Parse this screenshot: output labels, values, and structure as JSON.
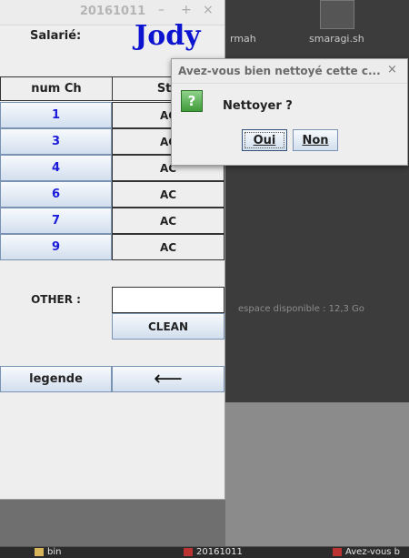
{
  "main_window": {
    "title": "20161011",
    "minimize": "–",
    "maximize": "+",
    "close": "×",
    "salarie_label": "Salarié:",
    "salarie_name": "Jody",
    "columns": [
      "num Ch",
      "Sta"
    ],
    "rows": [
      {
        "num": "1",
        "status": "AC"
      },
      {
        "num": "3",
        "status": "AC"
      },
      {
        "num": "4",
        "status": "AC"
      },
      {
        "num": "6",
        "status": "AC"
      },
      {
        "num": "7",
        "status": "AC"
      },
      {
        "num": "9",
        "status": "AC"
      }
    ],
    "other_label": "OTHER :",
    "other_value": "",
    "clean_label": "CLEAN",
    "legende_label": "legende",
    "back_symbol": "⟵"
  },
  "dialog": {
    "title": "Avez-vous bien nettoyé cette c...",
    "close": "×",
    "icon_glyph": "?",
    "message": "Nettoyer ?",
    "yes_label": "Oui",
    "no_label": "Non"
  },
  "background": {
    "file_1": "rmah",
    "file_2": "smaragi.sh",
    "free_space": "espace disponible : 12,3 Go"
  },
  "taskbar": {
    "item_1": "bin",
    "item_2": "20161011",
    "item_3": "Avez-vous b"
  },
  "colors": {
    "name_blue": "#0d14d0",
    "number_blue": "#1a1adb",
    "icon_green": "#3f9b3a"
  }
}
